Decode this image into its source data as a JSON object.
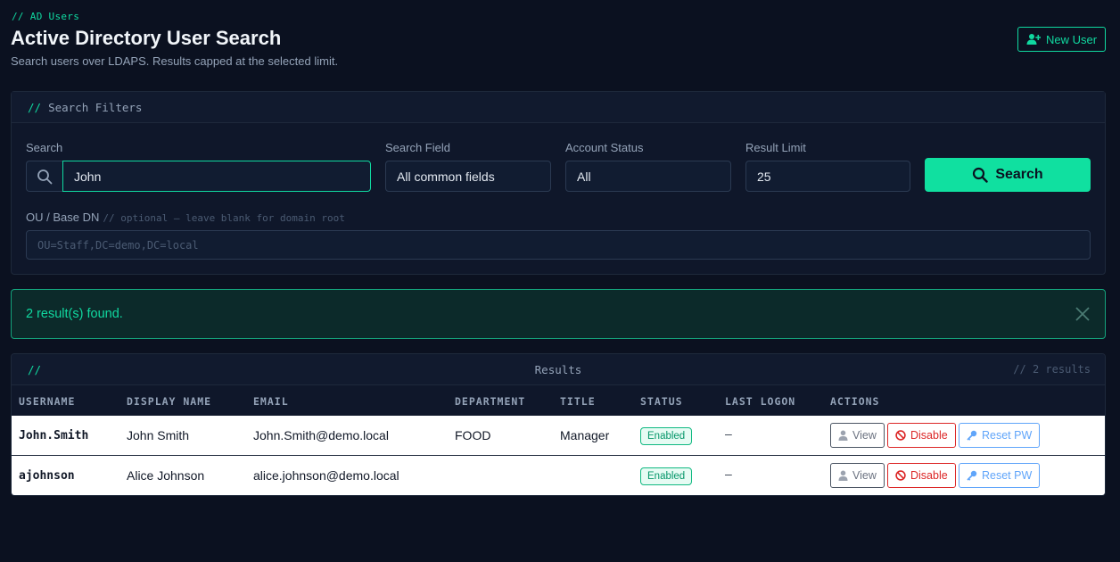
{
  "header": {
    "breadcrumb": "// AD Users",
    "title": "Active Directory User Search",
    "subtitle": "Search users over LDAPS. Results capped at the selected limit.",
    "new_user_label": "New User"
  },
  "filters": {
    "panel_slashes": "//",
    "panel_title": "Search Filters",
    "search_label": "Search",
    "search_value": "John",
    "search_field_label": "Search Field",
    "search_field_value": "All common fields",
    "account_status_label": "Account Status",
    "account_status_value": "All",
    "result_limit_label": "Result Limit",
    "result_limit_value": "25",
    "search_button_label": "Search",
    "ou_label": "OU / Base DN",
    "ou_hint": "// optional — leave blank for domain root",
    "ou_placeholder": "OU=Staff,DC=demo,DC=local"
  },
  "alert": {
    "message": "2 result(s) found."
  },
  "results": {
    "slashes": "//",
    "title": "Results",
    "count": "// 2 results",
    "columns": [
      "USERNAME",
      "DISPLAY NAME",
      "EMAIL",
      "DEPARTMENT",
      "TITLE",
      "STATUS",
      "LAST LOGON",
      "ACTIONS"
    ],
    "rows": [
      {
        "username": "John.Smith",
        "display_name": "John Smith",
        "email": "John.Smith@demo.local",
        "department": "FOOD",
        "title": "Manager",
        "status": "Enabled",
        "last_logon": "–"
      },
      {
        "username": "ajohnson",
        "display_name": "Alice Johnson",
        "email": "alice.johnson@demo.local",
        "department": "",
        "title": "",
        "status": "Enabled",
        "last_logon": "–"
      }
    ],
    "actions": {
      "view": "View",
      "disable": "Disable",
      "reset": "Reset PW"
    }
  },
  "colors": {
    "accent": "#10d9a0",
    "background": "#0b1120",
    "danger": "#dc2626",
    "info": "#60a5fa"
  },
  "icons": [
    "user-plus-icon",
    "search-icon",
    "close-icon",
    "user-icon",
    "ban-icon",
    "key-icon"
  ]
}
